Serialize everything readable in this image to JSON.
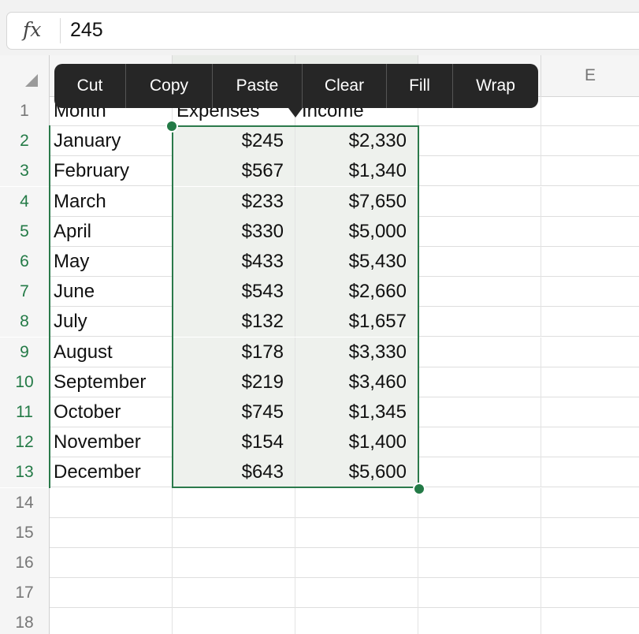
{
  "formula_bar": {
    "fx_label": "fx",
    "value": "245"
  },
  "column_headers": [
    "",
    "",
    "",
    "",
    "E"
  ],
  "context_menu": [
    "Cut",
    "Copy",
    "Paste",
    "Clear",
    "Fill",
    "Wrap"
  ],
  "rows": [
    {
      "num": "1",
      "a": "Month",
      "b": "Expenses",
      "c": "Income"
    },
    {
      "num": "2",
      "a": "January",
      "b": "$245",
      "c": "$2,330"
    },
    {
      "num": "3",
      "a": "February",
      "b": "$567",
      "c": "$1,340"
    },
    {
      "num": "4",
      "a": "March",
      "b": "$233",
      "c": "$7,650"
    },
    {
      "num": "5",
      "a": "April",
      "b": "$330",
      "c": "$5,000"
    },
    {
      "num": "6",
      "a": "May",
      "b": "$433",
      "c": "$5,430"
    },
    {
      "num": "7",
      "a": "June",
      "b": "$543",
      "c": "$2,660"
    },
    {
      "num": "8",
      "a": "July",
      "b": "$132",
      "c": "$1,657"
    },
    {
      "num": "9",
      "a": "August",
      "b": "$178",
      "c": "$3,330"
    },
    {
      "num": "10",
      "a": "September",
      "b": "$219",
      "c": "$3,460"
    },
    {
      "num": "11",
      "a": "October",
      "b": "$745",
      "c": "$1,345"
    },
    {
      "num": "12",
      "a": "November",
      "b": "$154",
      "c": "$1,400"
    },
    {
      "num": "13",
      "a": "December",
      "b": "$643",
      "c": "$5,600"
    },
    {
      "num": "14",
      "a": "",
      "b": "",
      "c": ""
    },
    {
      "num": "15",
      "a": "",
      "b": "",
      "c": ""
    },
    {
      "num": "16",
      "a": "",
      "b": "",
      "c": ""
    },
    {
      "num": "17",
      "a": "",
      "b": "",
      "c": ""
    },
    {
      "num": "18",
      "a": "",
      "b": "",
      "c": ""
    }
  ],
  "colors": {
    "selection": "#2b7a4b",
    "menu_bg": "#262626",
    "selected_fill": "#eef1ed"
  }
}
